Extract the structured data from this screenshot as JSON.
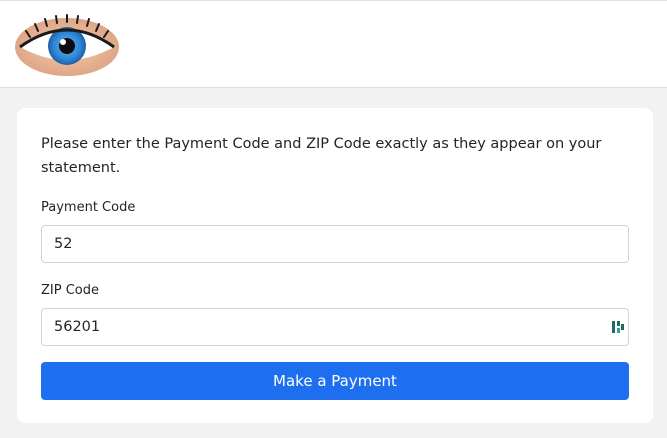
{
  "header": {
    "logo_icon": "eye-icon"
  },
  "form": {
    "intro_text": "Please enter the Payment Code and ZIP Code exactly as they appear on your statement.",
    "payment_code": {
      "label": "Payment Code",
      "value": "52"
    },
    "zip_code": {
      "label": "ZIP Code",
      "value": "56201",
      "autofill_icon": "password-manager-icon"
    },
    "submit_label": "Make a Payment"
  },
  "colors": {
    "button": "#1e6ff0",
    "page_bg": "#f2f2f2",
    "iris": "#3a8fd9"
  }
}
